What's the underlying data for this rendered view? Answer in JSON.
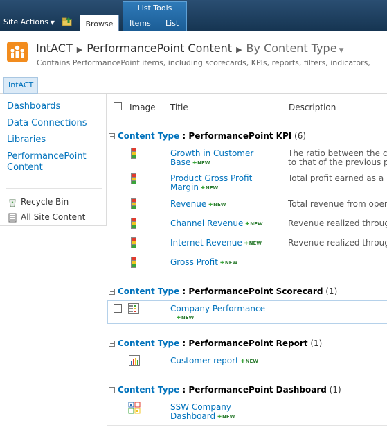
{
  "ribbon": {
    "site_actions": "Site Actions",
    "browse_tab": "Browse",
    "list_tools_label": "List Tools",
    "items_tab": "Items",
    "list_tab": "List"
  },
  "title": {
    "site": "IntACT",
    "list": "PerformancePoint Content",
    "view": "By Content Type",
    "description": "Contains PerformancePoint items, including scorecards, KPIs, reports, filters, indicators,"
  },
  "breadcrumb": {
    "home": "IntACT"
  },
  "left_nav": {
    "links": [
      "Dashboards",
      "Data Connections",
      "Libraries",
      "PerformancePoint Content"
    ],
    "recycle_bin": "Recycle Bin",
    "all_site_content": "All Site Content"
  },
  "columns": {
    "image": "Image",
    "title": "Title",
    "description": "Description"
  },
  "new_label": "NEW",
  "groups": [
    {
      "label": "Content Type",
      "name": "PerformancePoint KPI",
      "count": "(6)",
      "items": [
        {
          "title": "Growth in Customer Base",
          "description": "The ratio between the cu\nto that of the previous pe"
        },
        {
          "title": "Product Gross Profit Margin",
          "description": "Total profit earned as a p"
        },
        {
          "title": "Revenue",
          "description": "Total revenue from opera"
        },
        {
          "title": "Channel Revenue",
          "description": "Revenue realized through"
        },
        {
          "title": "Internet Revenue",
          "description": "Revenue realized through"
        },
        {
          "title": "Gross Profit",
          "description": ""
        }
      ]
    },
    {
      "label": "Content Type",
      "name": "PerformancePoint Scorecard",
      "count": "(1)",
      "items": [
        {
          "title": "Company Performance",
          "description": ""
        }
      ]
    },
    {
      "label": "Content Type",
      "name": "PerformancePoint Report",
      "count": "(1)",
      "items": [
        {
          "title": "Customer report",
          "description": ""
        }
      ]
    },
    {
      "label": "Content Type",
      "name": "PerformancePoint Dashboard",
      "count": "(1)",
      "items": [
        {
          "title": "SSW Company Dashboard",
          "description": ""
        }
      ]
    }
  ]
}
